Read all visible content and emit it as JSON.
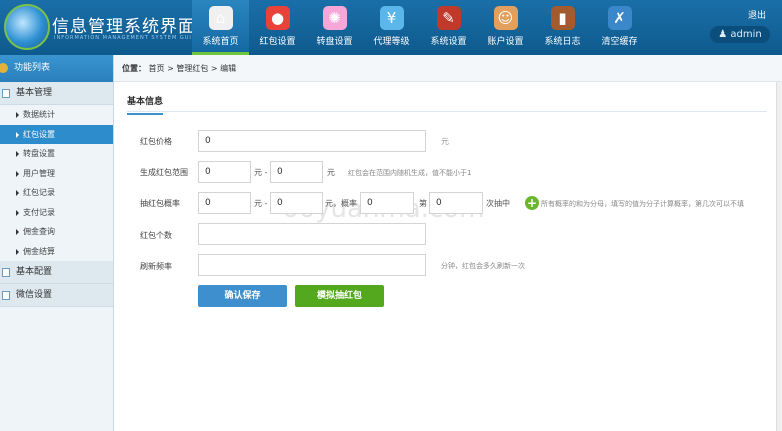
{
  "header": {
    "title": "信息管理系统界面",
    "subtitle": "INFORMATION MANAGEMENT SYSTEM GUI",
    "logout": "退出",
    "user": "admin",
    "nav": [
      {
        "label": "系统首页",
        "icon": "home-icon",
        "color": "#f0f0f0",
        "active": true
      },
      {
        "label": "红包设置",
        "icon": "red-packet-icon",
        "color": "#e8423b"
      },
      {
        "label": "转盘设置",
        "icon": "wheel-icon",
        "color": "#f7a6d8"
      },
      {
        "label": "代理等级",
        "icon": "yen-cloud-icon",
        "color": "#5bb6ea"
      },
      {
        "label": "系统设置",
        "icon": "tools-icon",
        "color": "#c03a2b"
      },
      {
        "label": "账户设置",
        "icon": "user-icon",
        "color": "#e3a05c"
      },
      {
        "label": "系统日志",
        "icon": "book-icon",
        "color": "#a35a2c"
      },
      {
        "label": "清空缓存",
        "icon": "clear-icon",
        "color": "#3a88c9"
      }
    ]
  },
  "sidebar": {
    "title": "功能列表",
    "groups": [
      {
        "label": "基本管理",
        "items": [
          "数据统计",
          "红包设置",
          "转盘设置",
          "用户管理",
          "红包记录",
          "支付记录",
          "佣金查询",
          "佣金结算"
        ]
      },
      {
        "label": "基本配置"
      },
      {
        "label": "微信设置"
      }
    ],
    "active_item": "红包设置"
  },
  "breadcrumb": {
    "prefix": "位置：",
    "items": [
      "首页",
      "管理红包",
      "编辑"
    ],
    "sep": ">"
  },
  "section_title": "基本信息",
  "form": {
    "price": {
      "label": "红包价格",
      "value": "0",
      "unit": "元"
    },
    "range": {
      "label": "生成红包范围",
      "min": "0",
      "max": "0",
      "sep": "元 -",
      "unit": "元",
      "hint": "红包会在范围内随机生成，值不能小于1"
    },
    "prob": {
      "label": "抽红包概率",
      "min": "0",
      "max": "0",
      "sep": "元 -",
      "unit_prob": "元，概率",
      "prob": "0",
      "nth_label": "第",
      "nth": "0",
      "suffix": "次抽中",
      "hint": "所有概率的和为分母，填写的值为分子计算概率，第几次可以不填"
    },
    "count": {
      "label": "红包个数",
      "value": ""
    },
    "refresh": {
      "label": "刷新频率",
      "value": "",
      "hint": "分钟，红包会多久刷新一次"
    }
  },
  "buttons": {
    "save": "确认保存",
    "simulate": "模拟抽红包"
  },
  "watermark": "66yuanma.com"
}
